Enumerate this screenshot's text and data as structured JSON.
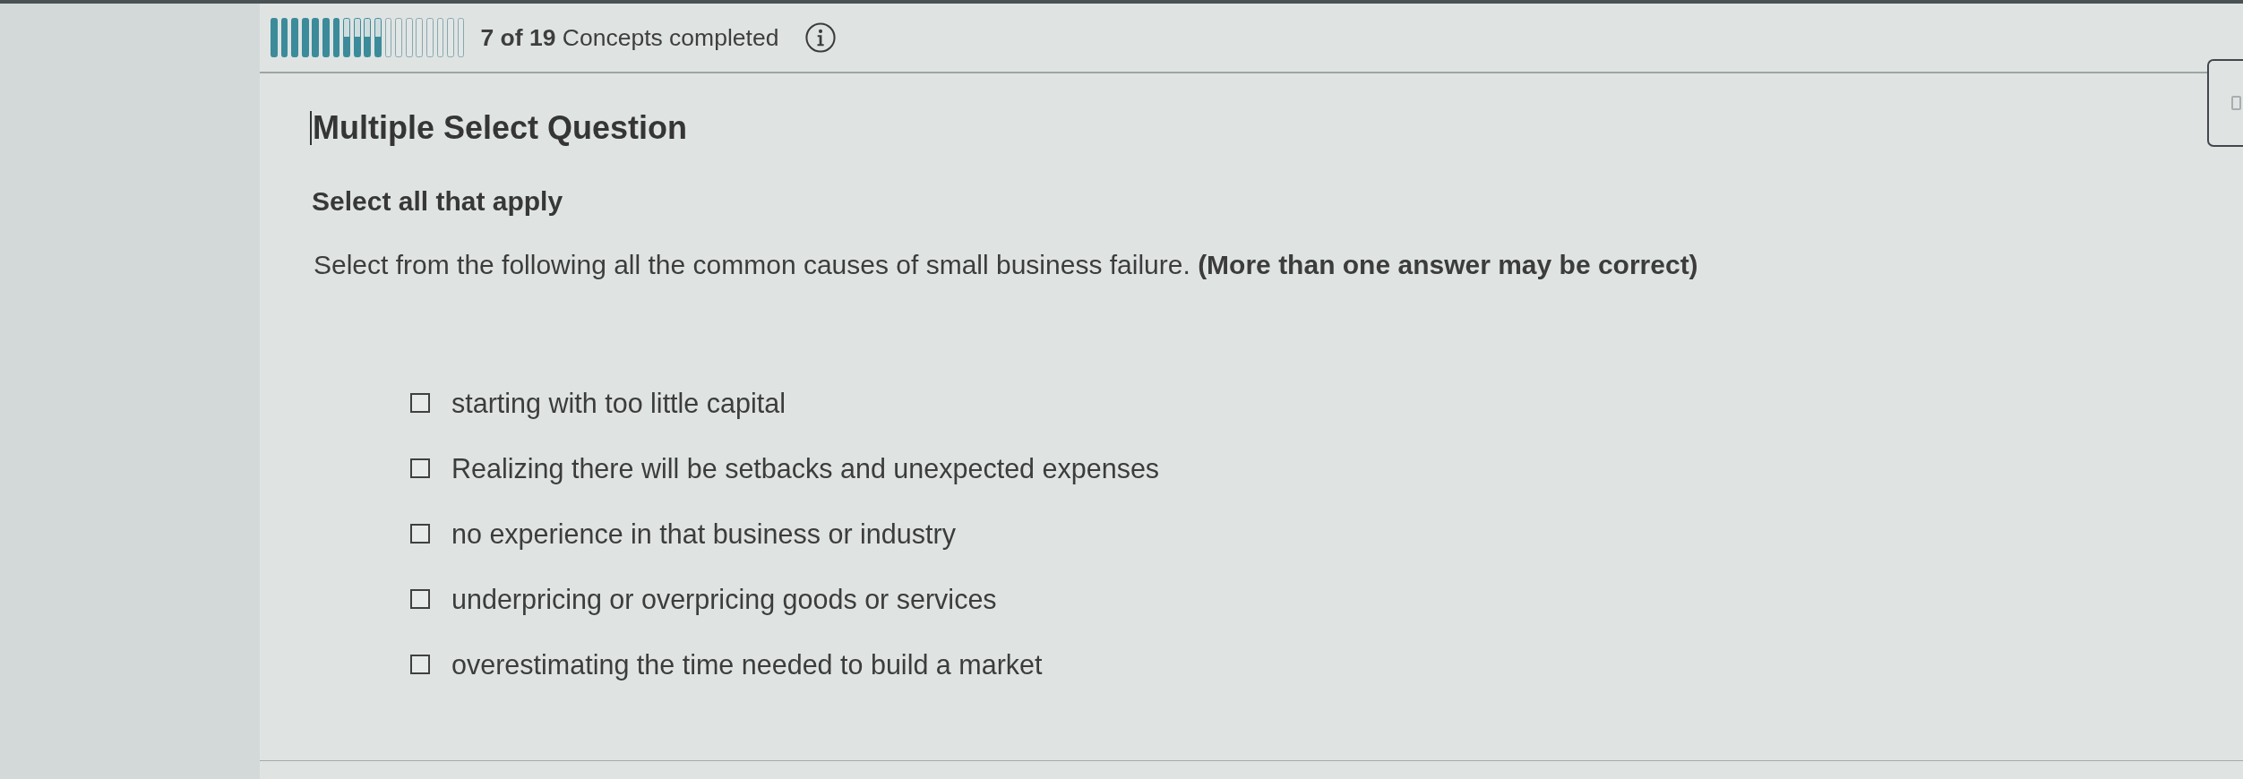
{
  "progress": {
    "segments": [
      {
        "kind": "complete"
      },
      {
        "kind": "complete"
      },
      {
        "kind": "complete"
      },
      {
        "kind": "complete"
      },
      {
        "kind": "complete"
      },
      {
        "kind": "complete"
      },
      {
        "kind": "complete"
      },
      {
        "kind": "partial"
      },
      {
        "kind": "partial"
      },
      {
        "kind": "partial"
      },
      {
        "kind": "partial"
      },
      {
        "kind": "empty"
      },
      {
        "kind": "empty"
      },
      {
        "kind": "empty"
      },
      {
        "kind": "empty"
      },
      {
        "kind": "empty"
      },
      {
        "kind": "empty"
      },
      {
        "kind": "empty"
      },
      {
        "kind": "empty"
      }
    ],
    "label": "**7 of 19** Concepts completed"
  },
  "question": {
    "type_label": "Multiple Select Question",
    "instruction": "Select all that apply",
    "prompt": "Select from the following all the common causes of small business failure. **(More than one answer may be correct)**",
    "options": [
      {
        "label": "starting with too little capital",
        "checked": false
      },
      {
        "label": "Realizing there will be setbacks and unexpected expenses",
        "checked": false
      },
      {
        "label": "no experience in that business or industry",
        "checked": false
      },
      {
        "label": "underpricing or overpricing goods or services",
        "checked": false
      },
      {
        "label": "overestimating the time needed to build a market",
        "checked": false
      }
    ]
  }
}
